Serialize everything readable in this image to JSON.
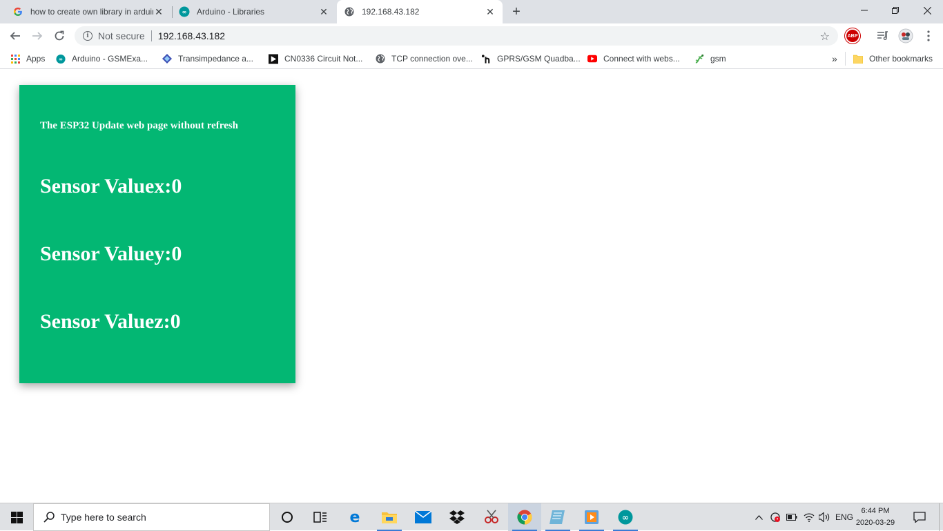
{
  "browser": {
    "tabs": [
      {
        "title": "how to create own library in arduino",
        "icon": "google-icon",
        "active": false
      },
      {
        "title": "Arduino - Libraries",
        "icon": "arduino-icon",
        "active": false
      },
      {
        "title": "192.168.43.182",
        "icon": "globe-icon",
        "active": true
      }
    ],
    "new_tab_label": "+",
    "omnibox": {
      "security_label": "Not secure",
      "url": "192.168.43.182"
    },
    "bookmarks": [
      {
        "label": "Apps",
        "icon": "apps-grid-icon"
      },
      {
        "label": "Arduino - GSMExa...",
        "icon": "arduino-icon"
      },
      {
        "label": "Transimpedance a...",
        "icon": "diamond-icon"
      },
      {
        "label": "CN0336 Circuit Not...",
        "icon": "play-icon"
      },
      {
        "label": "TCP connection ove...",
        "icon": "globe-icon"
      },
      {
        "label": "GPRS/GSM Quadba...",
        "icon": "hackster-icon"
      },
      {
        "label": "Connect with webs...",
        "icon": "youtube-icon"
      },
      {
        "label": "gsm",
        "icon": "gecko-icon"
      }
    ],
    "overflow_label": "»",
    "other_bookmarks_label": "Other bookmarks"
  },
  "page": {
    "heading": "The ESP32 Update web page without refresh",
    "readings": [
      {
        "label": "Sensor Valuex:0"
      },
      {
        "label": "Sensor Valuey:0"
      },
      {
        "label": "Sensor Valuez:0"
      }
    ],
    "card_color": "#03b773"
  },
  "taskbar": {
    "search_placeholder": "Type here to search",
    "language": "ENG",
    "time": "6:44 PM",
    "date": "2020-03-29",
    "apps": [
      "cortana-icon",
      "task-view-icon",
      "edge-icon",
      "file-explorer-icon",
      "mail-icon",
      "dropbox-icon",
      "snipping-tool-icon",
      "chrome-icon",
      "notepad-icon",
      "media-player-icon",
      "arduino-icon"
    ]
  }
}
